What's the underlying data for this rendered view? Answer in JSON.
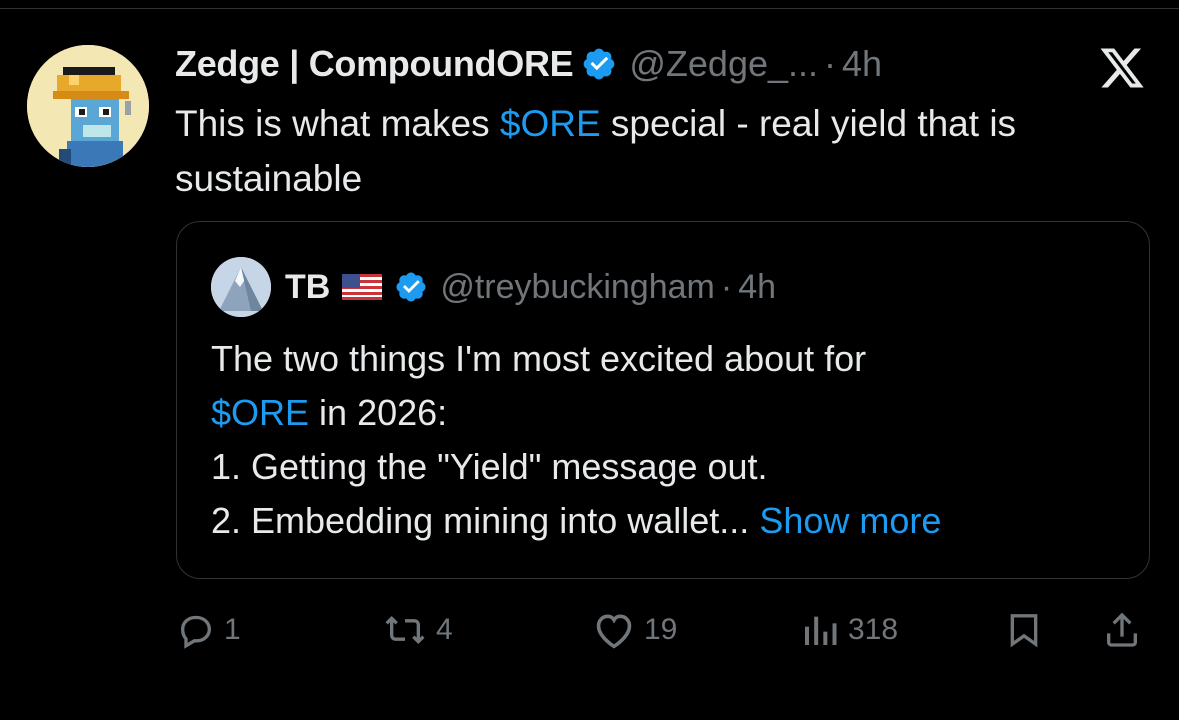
{
  "tweet": {
    "author": {
      "display_name": "Zedge | CompoundORE",
      "handle": "@Zedge_...",
      "verified": true,
      "avatar_icon": "pixel-miner-avatar"
    },
    "separator": "·",
    "time": "4h",
    "text": {
      "prefix": "This is what makes ",
      "cashtag": "$ORE",
      "suffix": " special - real yield that is sustainable"
    },
    "platform_icon": "x-logo-icon"
  },
  "quote": {
    "author": {
      "display_name": "TB",
      "flag_icon": "us-flag-icon",
      "verified": true,
      "handle": "@treybuckingham",
      "avatar_icon": "mountain-avatar"
    },
    "separator": "·",
    "time": "4h",
    "body": {
      "line1": "The two things I'm most excited about for",
      "line2_cashtag": "$ORE",
      "line2_rest": " in 2026:",
      "line3": "1. Getting the \"Yield\" message out.",
      "line4": "2. Embedding mining into wallet...",
      "show_more": "Show more"
    }
  },
  "actions": {
    "replies": "1",
    "reposts": "4",
    "likes": "19",
    "views": "318"
  },
  "colors": {
    "background": "#000000",
    "text": "#e7e9ea",
    "muted": "#71767b",
    "accent": "#1d9bf0",
    "border": "#2f3336"
  }
}
